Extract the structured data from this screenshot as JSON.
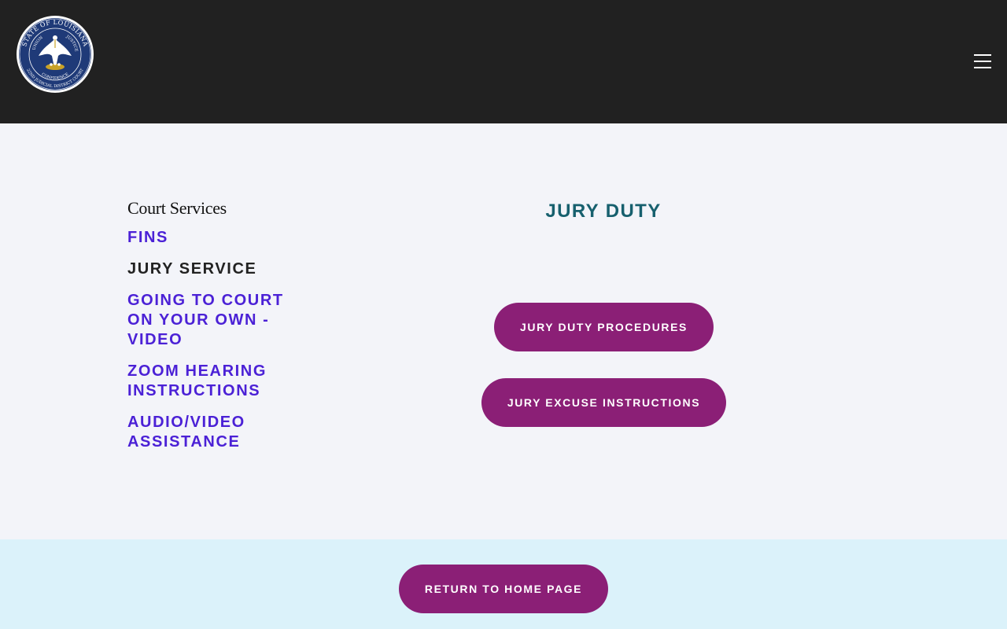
{
  "header": {
    "seal": {
      "outer_text": "STATE OF LOUISIANA",
      "inner_top_left": "UNION",
      "inner_top_right": "JUSTICE",
      "inner_bottom": "CONFIDENCE",
      "outer_bottom": "22ND JUDICIAL DISTRICT COURT",
      "colors": {
        "ring": "#ffffff",
        "field": "#1f3a78",
        "pelican": "#ffffff",
        "nest": "#c9a227"
      }
    },
    "menu_icon": "hamburger-icon"
  },
  "sidebar": {
    "title": "Court Services",
    "items": [
      {
        "label": "FINS",
        "current": false
      },
      {
        "label": "JURY SERVICE",
        "current": true
      },
      {
        "label": "GOING TO COURT ON YOUR OWN - VIDEO",
        "current": false
      },
      {
        "label": "ZOOM HEARING INSTRUCTIONS",
        "current": false
      },
      {
        "label": "AUDIO/VIDEO ASSISTANCE",
        "current": false
      }
    ]
  },
  "main": {
    "title": "JURY DUTY",
    "buttons": [
      {
        "label": "JURY DUTY PROCEDURES"
      },
      {
        "label": "JURY EXCUSE INSTRUCTIONS"
      }
    ]
  },
  "footer": {
    "home_button": "RETURN TO HOME PAGE"
  },
  "colors": {
    "header_bg": "#212121",
    "page_bg": "#f3f4f9",
    "footer_bg": "#dbf2fa",
    "link": "#4b21d6",
    "current_link": "#222222",
    "title": "#17606e",
    "button": "#8b1f76"
  }
}
